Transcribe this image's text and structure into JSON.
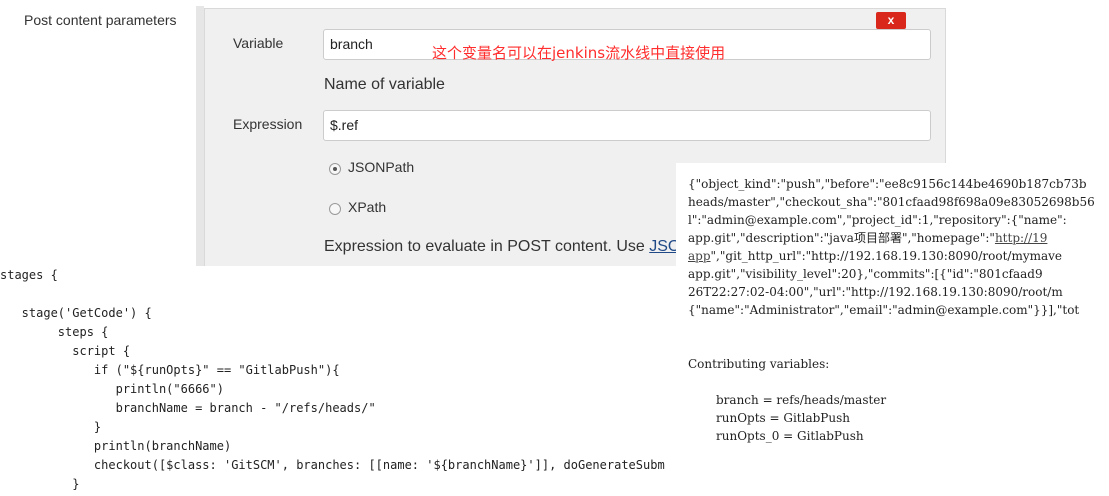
{
  "section": {
    "label": "Post content parameters"
  },
  "panel": {
    "delete_label": "x",
    "variable_label": "Variable",
    "variable_value": "branch",
    "annotation": "这个变量名可以在jenkins流水线中直接使用",
    "variable_help": "Name of variable",
    "expression_label": "Expression",
    "expression_value": "$.ref",
    "radio_jsonpath": "JSONPath",
    "radio_xpath": "XPath",
    "expression_help_prefix": "Expression to evaluate in POST content. Use ",
    "expression_help_link": "JSON",
    "selected_radio": "JSONPath"
  },
  "code_lines": [
    "stages {",
    "",
    "   stage('GetCode') {",
    "        steps {",
    "          script {",
    "             if (\"${runOpts}\" == \"GitlabPush\"){",
    "                println(\"6666\")",
    "                branchName = branch - \"/refs/heads/\"",
    "             }",
    "             println(branchName)",
    "             checkout([$class: 'GitSCM', branches: [[name: '${branchName}']], doGenerateSubm",
    "          }"
  ],
  "json_output": {
    "lines": [
      "{\"object_kind\":\"push\",\"before\":\"ee8c9156c144be4690b187cb73b",
      "heads/master\",\"checkout_sha\":\"801cfaad98f698a09e83052698b56",
      "l\":\"admin@example.com\",\"project_id\":1,\"repository\":{\"name\":",
      "app.git\",\"description\":\"java项目部署\",\"homepage\":\"",
      "app\",\"git_http_url\":\"http://192.168.19.130:8090/root/mymave",
      "app.git\",\"visibility_level\":20},\"commits\":[{\"id\":\"801cfaad9",
      "26T22:27:02-04:00\",\"url\":\"http://192.168.19.130:8090/root/m",
      "{\"name\":\"Administrator\",\"email\":\"admin@example.com\"}}],\"tot"
    ],
    "homepage_link": "http://19",
    "line5_link_part": "app",
    "contributing_label": "Contributing variables:",
    "variables": [
      "branch = refs/heads/master",
      "runOpts = GitlabPush",
      "runOpts_0 = GitlabPush"
    ]
  }
}
